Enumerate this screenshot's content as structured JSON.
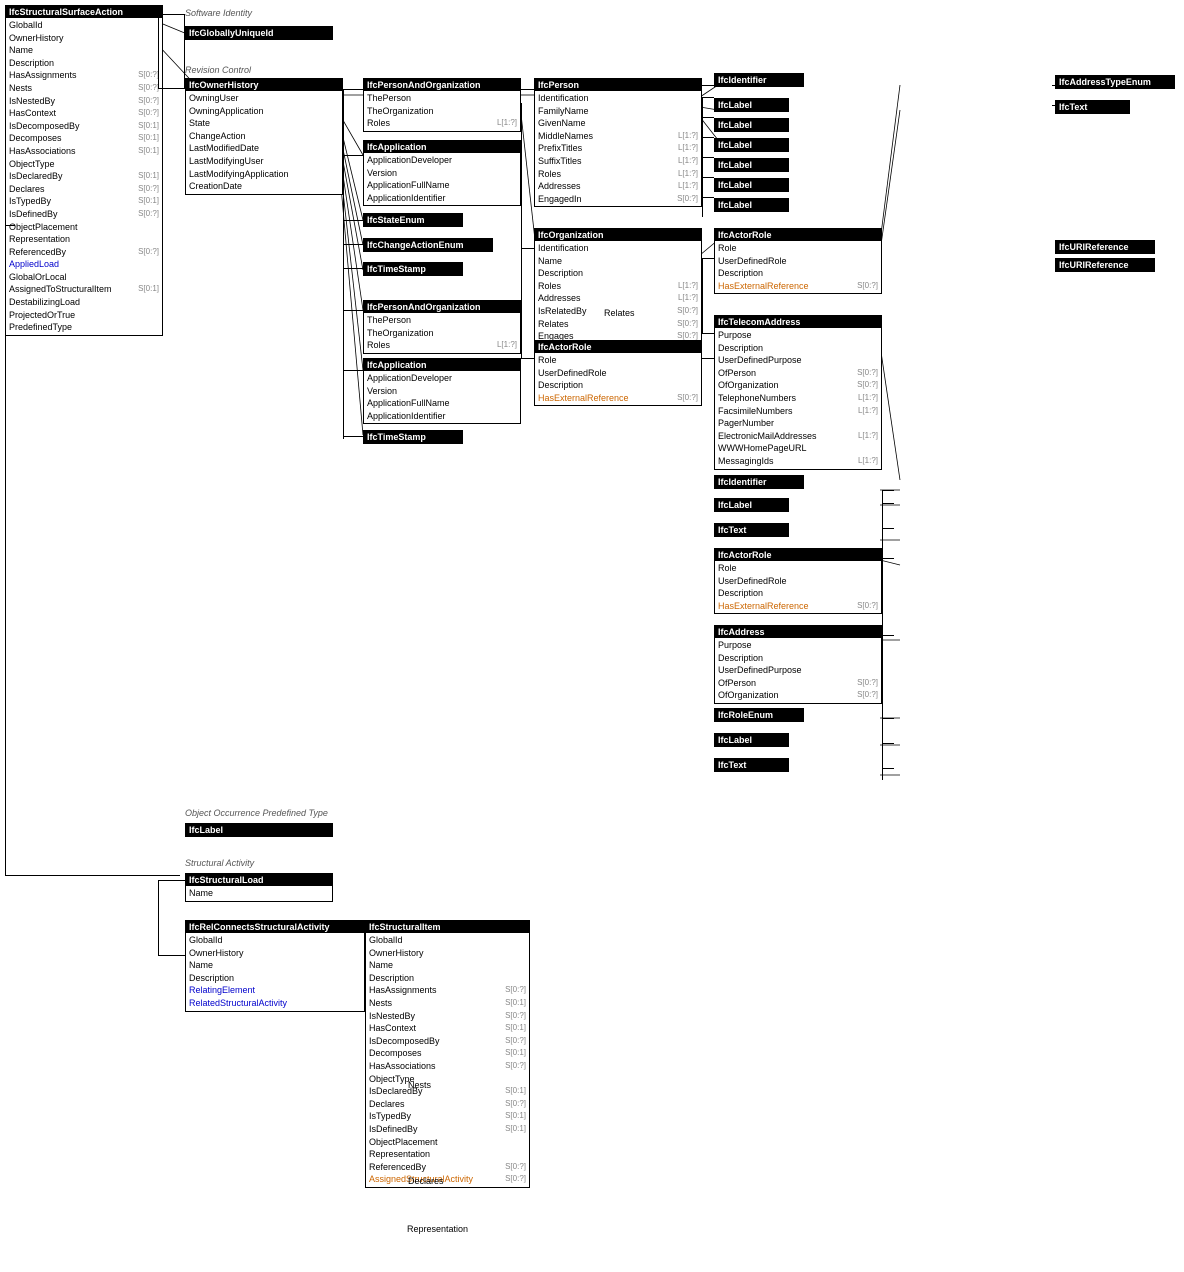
{
  "sections": {
    "softwareIdentity": "Software Identity",
    "revisionControl": "Revision Control",
    "objectOccurrencePredefinedType": "Object Occurrence Predefined Type",
    "structuralActivity": "Structural Activity"
  },
  "boxes": {
    "ifcStructuralSurfaceAction": {
      "header": "IfcStructuralSurfaceAction",
      "fields": [
        {
          "name": "GlobalId",
          "type": ""
        },
        {
          "name": "OwnerHistory",
          "type": ""
        },
        {
          "name": "Name",
          "type": ""
        },
        {
          "name": "Description",
          "type": ""
        },
        {
          "name": "HasAssignments",
          "type": "S[0:?]"
        },
        {
          "name": "Nests",
          "type": "S[0:?]"
        },
        {
          "name": "IsNestedBy",
          "type": "S[0:?]"
        },
        {
          "name": "HasContext",
          "type": "S[0:?]"
        },
        {
          "name": "IsDecomposedBy",
          "type": "S[0:1]"
        },
        {
          "name": "Decomposes",
          "type": "S[0:1]"
        },
        {
          "name": "HasAssociations",
          "type": "S[0:1]"
        },
        {
          "name": "ObjectType",
          "type": ""
        },
        {
          "name": "IsDeclaredBy",
          "type": "S[0:1]"
        },
        {
          "name": "Declares",
          "type": "S[0:?]"
        },
        {
          "name": "IsTypedBy",
          "type": "S[0:1]"
        },
        {
          "name": "IsDefinedBy",
          "type": "S[0:?]"
        },
        {
          "name": "ObjectPlacement",
          "type": ""
        },
        {
          "name": "Representation",
          "type": ""
        },
        {
          "name": "ReferencedBy",
          "type": "S[0:?]"
        },
        {
          "name": "AppliedLoad",
          "type": ""
        },
        {
          "name": "GlobalOrLocal",
          "type": ""
        },
        {
          "name": "AssignedToStructuralItem",
          "type": "S[0:1]"
        },
        {
          "name": "DestabilizingLoad",
          "type": ""
        },
        {
          "name": "ProjectedOrTrue",
          "type": ""
        },
        {
          "name": "PredefinedType",
          "type": ""
        }
      ]
    },
    "ifcGloballyUniqueId": {
      "header": "IfcGloballyUniqueId"
    },
    "ifcOwnerHistory": {
      "header": "IfcOwnerHistory",
      "fields": [
        {
          "name": "OwningUser",
          "type": ""
        },
        {
          "name": "OwningApplication",
          "type": ""
        },
        {
          "name": "State",
          "type": ""
        },
        {
          "name": "ChangeAction",
          "type": ""
        },
        {
          "name": "LastModifiedDate",
          "type": ""
        },
        {
          "name": "LastModifyingUser",
          "type": ""
        },
        {
          "name": "LastModifyingApplication",
          "type": ""
        },
        {
          "name": "CreationDate",
          "type": ""
        }
      ]
    },
    "ifcPersonAndOrg1": {
      "header": "IfcPersonAndOrganization",
      "fields": [
        {
          "name": "ThePerson",
          "type": ""
        },
        {
          "name": "TheOrganization",
          "type": ""
        },
        {
          "name": "Roles",
          "type": "L[1:?]"
        }
      ]
    },
    "ifcApplication1": {
      "header": "IfcApplication",
      "fields": [
        {
          "name": "ApplicationDeveloper",
          "type": ""
        },
        {
          "name": "Version",
          "type": ""
        },
        {
          "name": "ApplicationFullName",
          "type": ""
        },
        {
          "name": "ApplicationIdentifier",
          "type": ""
        }
      ]
    },
    "ifcStateEnum": {
      "header": "IfcStateEnum"
    },
    "ifcChangeActionEnum": {
      "header": "IfcChangeActionEnum"
    },
    "ifcTimeStamp1": {
      "header": "IfcTimeStamp"
    },
    "ifcPersonAndOrg2": {
      "header": "IfcPersonAndOrganization",
      "fields": [
        {
          "name": "ThePerson",
          "type": ""
        },
        {
          "name": "TheOrganization",
          "type": ""
        },
        {
          "name": "Roles",
          "type": "L[1:?]"
        }
      ]
    },
    "ifcApplication2": {
      "header": "IfcApplication",
      "fields": [
        {
          "name": "ApplicationDeveloper",
          "type": ""
        },
        {
          "name": "Version",
          "type": ""
        },
        {
          "name": "ApplicationFullName",
          "type": ""
        },
        {
          "name": "ApplicationIdentifier",
          "type": ""
        }
      ]
    },
    "ifcTimeStamp2": {
      "header": "IfcTimeStamp"
    },
    "ifcPerson": {
      "header": "IfcPerson",
      "fields": [
        {
          "name": "Identification",
          "type": ""
        },
        {
          "name": "FamilyName",
          "type": ""
        },
        {
          "name": "GivenName",
          "type": ""
        },
        {
          "name": "MiddleNames",
          "type": "L[1:?]"
        },
        {
          "name": "PrefixTitles",
          "type": "L[1:?]"
        },
        {
          "name": "SuffixTitles",
          "type": "L[1:?]"
        },
        {
          "name": "Roles",
          "type": "L[1:?]"
        },
        {
          "name": "Addresses",
          "type": "L[1:?]"
        },
        {
          "name": "EngagedIn",
          "type": "S[0:?]"
        }
      ]
    },
    "ifcOrganization": {
      "header": "IfcOrganization",
      "fields": [
        {
          "name": "Identification",
          "type": ""
        },
        {
          "name": "Name",
          "type": ""
        },
        {
          "name": "Description",
          "type": ""
        },
        {
          "name": "Roles",
          "type": "L[1:?]"
        },
        {
          "name": "Addresses",
          "type": "L[1:?]"
        },
        {
          "name": "IsRelatedBy",
          "type": "S[0:?]"
        },
        {
          "name": "Relates",
          "type": "S[0:?]"
        },
        {
          "name": "Engages",
          "type": "S[0:?]"
        }
      ]
    },
    "ifcActorRole1": {
      "header": "IfcActorRole",
      "fields": [
        {
          "name": "Role",
          "type": ""
        },
        {
          "name": "UserDefinedRole",
          "type": ""
        },
        {
          "name": "Description",
          "type": ""
        },
        {
          "name": "HasExternalReference",
          "type": "S[0:?]"
        }
      ]
    },
    "ifcIdentifier1": {
      "header": "IfcIdentifier"
    },
    "ifcLabel1": {
      "header": "IfcLabel"
    },
    "ifcLabel2": {
      "header": "IfcLabel"
    },
    "ifcLabel3": {
      "header": "IfcLabel"
    },
    "ifcLabel4": {
      "header": "IfcLabel"
    },
    "ifcLabel5": {
      "header": "IfcLabel"
    },
    "ifcLabel6": {
      "header": "IfcLabel"
    },
    "ifcActorRole2": {
      "header": "IfcActorRole",
      "fields": [
        {
          "name": "Role",
          "type": ""
        },
        {
          "name": "UserDefinedRole",
          "type": ""
        },
        {
          "name": "Description",
          "type": ""
        },
        {
          "name": "HasExternalReference",
          "type": "S[0:?]"
        }
      ]
    },
    "ifcTelecomAddress": {
      "header": "IfcTelecomAddress",
      "fields": [
        {
          "name": "Purpose",
          "type": ""
        },
        {
          "name": "Description",
          "type": ""
        },
        {
          "name": "UserDefinedPurpose",
          "type": ""
        },
        {
          "name": "OfPerson",
          "type": "S[0:?]"
        },
        {
          "name": "OfOrganization",
          "type": "S[0:?]"
        },
        {
          "name": "TelephoneNumbers",
          "type": "L[1:?]"
        },
        {
          "name": "FacsimileNumbers",
          "type": "L[1:?]"
        },
        {
          "name": "PagerNumber",
          "type": ""
        },
        {
          "name": "ElectronicMailAddresses",
          "type": "L[1:?]"
        },
        {
          "name": "WWWHomePageURL",
          "type": ""
        },
        {
          "name": "MessagingIds",
          "type": "L[1:?]"
        }
      ]
    },
    "ifcIdentifier2": {
      "header": "IfcIdentifier"
    },
    "ifcLabel7": {
      "header": "IfcLabel"
    },
    "ifcText": {
      "header": "IfcText"
    },
    "ifcActorRole3": {
      "header": "IfcActorRole",
      "fields": [
        {
          "name": "Role",
          "type": ""
        },
        {
          "name": "UserDefinedRole",
          "type": ""
        },
        {
          "name": "Description",
          "type": ""
        },
        {
          "name": "HasExternalReference",
          "type": "S[0:?]"
        }
      ]
    },
    "ifcAddress": {
      "header": "IfcAddress",
      "fields": [
        {
          "name": "Purpose",
          "type": ""
        },
        {
          "name": "Description",
          "type": ""
        },
        {
          "name": "UserDefinedPurpose",
          "type": ""
        },
        {
          "name": "OfPerson",
          "type": "S[0:?]"
        },
        {
          "name": "OfOrganization",
          "type": "S[0:?]"
        }
      ]
    },
    "ifcRoleEnum": {
      "header": "IfcRoleEnum"
    },
    "ifcLabel8": {
      "header": "IfcLabel"
    },
    "ifcText2": {
      "header": "IfcText"
    },
    "ifcAddressTypeEnum": {
      "header": "IfcAddressTypeEnum"
    },
    "ifcText3": {
      "header": "IfcText"
    },
    "ifcURIReference1": {
      "header": "IfcURIReference"
    },
    "ifcURIReference2": {
      "header": "IfcURIReference"
    },
    "ifcLabel9": {
      "header": "IfcLabel"
    },
    "ifcStructuralLoad": {
      "header": "IfcStructuralLoad",
      "fields": [
        {
          "name": "Name",
          "type": ""
        }
      ]
    },
    "ifcRelConnectsStructuralActivity": {
      "header": "IfcRelConnectsStructuralActivity",
      "fields": [
        {
          "name": "GlobalId",
          "type": ""
        },
        {
          "name": "OwnerHistory",
          "type": ""
        },
        {
          "name": "Name",
          "type": ""
        },
        {
          "name": "Description",
          "type": ""
        },
        {
          "name": "RelatingElement",
          "type": ""
        },
        {
          "name": "RelatedStructuralActivity",
          "type": ""
        }
      ]
    },
    "ifcStructuralItem": {
      "header": "IfcStructuralItem",
      "fields": [
        {
          "name": "GlobalId",
          "type": ""
        },
        {
          "name": "OwnerHistory",
          "type": ""
        },
        {
          "name": "Name",
          "type": ""
        },
        {
          "name": "Description",
          "type": ""
        },
        {
          "name": "HasAssignments",
          "type": "S[0:?]"
        },
        {
          "name": "Nests",
          "type": "S[0:1]"
        },
        {
          "name": "IsNestedBy",
          "type": "S[0:?]"
        },
        {
          "name": "HasContext",
          "type": "S[0:1]"
        },
        {
          "name": "IsDecomposedBy",
          "type": "S[0:?]"
        },
        {
          "name": "Decomposes",
          "type": "S[0:1]"
        },
        {
          "name": "HasAssociations",
          "type": "S[0:?]"
        },
        {
          "name": "ObjectType",
          "type": ""
        },
        {
          "name": "IsDeclaredBy",
          "type": "S[0:1]"
        },
        {
          "name": "Declares",
          "type": "S[0:?]"
        },
        {
          "name": "IsTypedBy",
          "type": "S[0:1]"
        },
        {
          "name": "IsDefinedBy",
          "type": "S[0:1]"
        },
        {
          "name": "ObjectPlacement",
          "type": ""
        },
        {
          "name": "Representation",
          "type": ""
        },
        {
          "name": "ReferencedBy",
          "type": "S[0:?]"
        },
        {
          "name": "AssignedStructuralActivity",
          "type": "S[0:?]"
        }
      ]
    }
  }
}
